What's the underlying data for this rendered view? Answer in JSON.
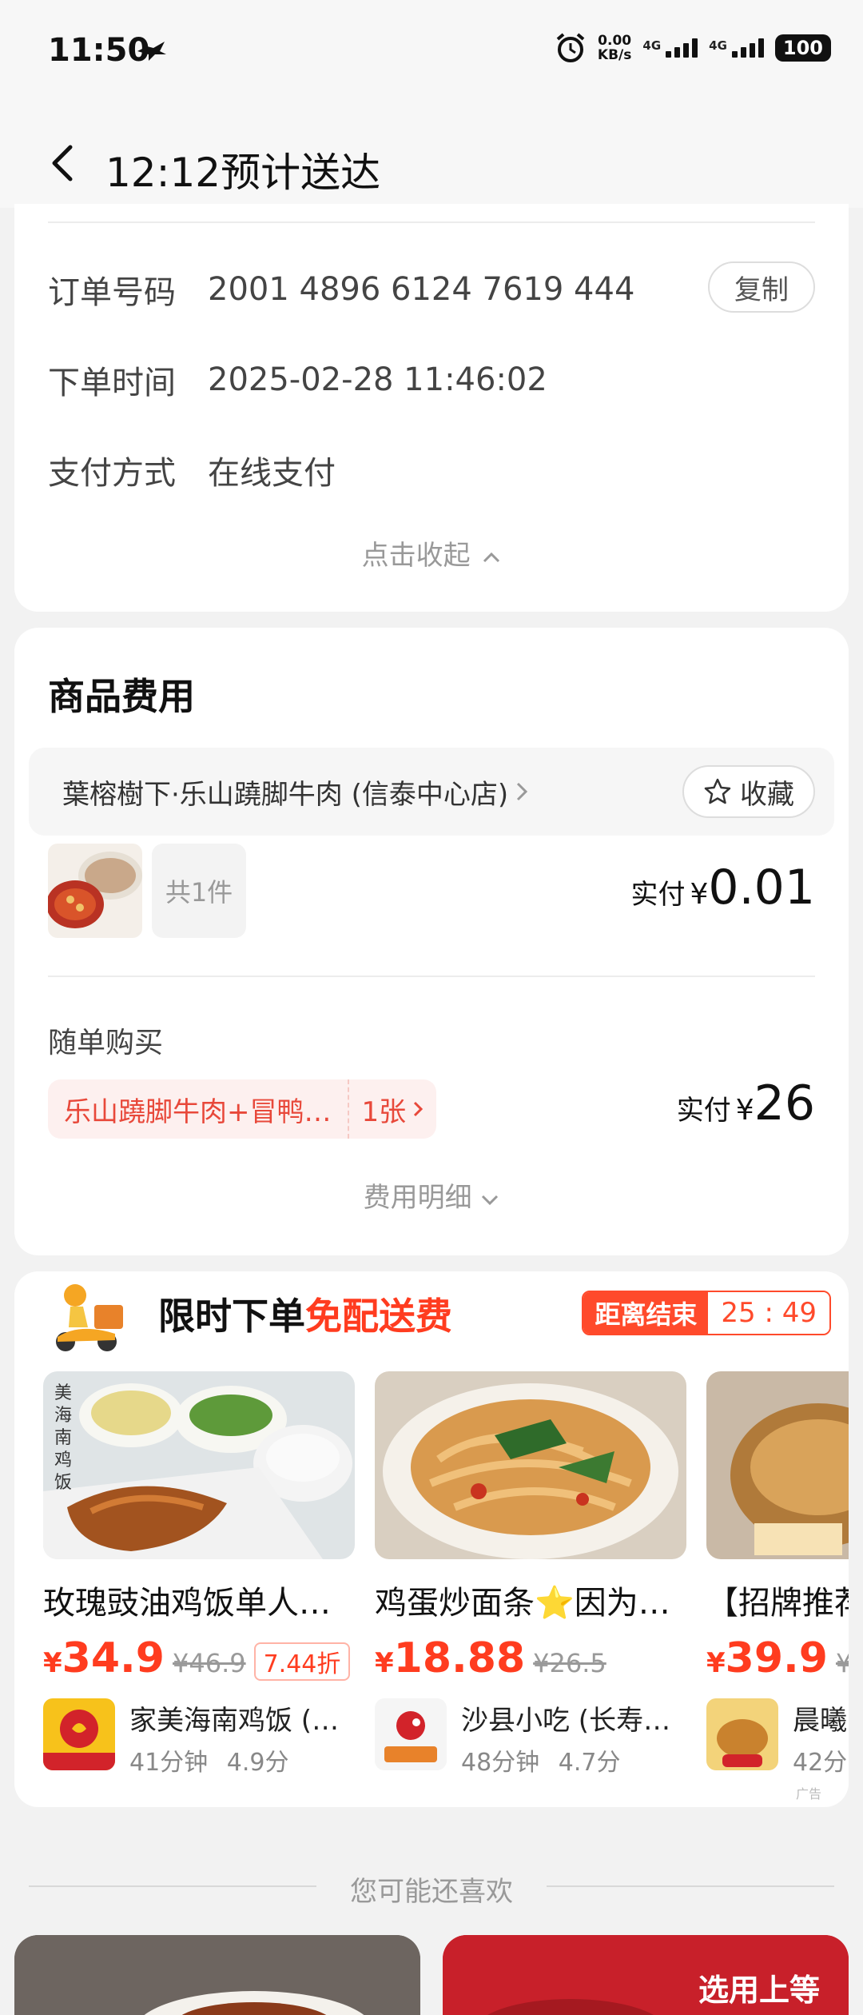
{
  "status_bar": {
    "time": "11:50",
    "net_speed": "0.00",
    "net_unit": "KB/s",
    "sig1": "4G",
    "sig2": "4G",
    "battery": "100"
  },
  "header": {
    "title": "12:12预计送达"
  },
  "order_info": {
    "order_no_label": "订单号码",
    "order_no": "2001 4896 6124 7619 444",
    "copy_label": "复制",
    "time_label": "下单时间",
    "time": "2025-02-28 11:46:02",
    "pay_label": "支付方式",
    "pay": "在线支付",
    "collapse_label": "点击收起"
  },
  "goods": {
    "title": "商品费用",
    "shop_name": "葉榕樹下·乐山蹺脚牛肉 (信泰中心店)",
    "fav_label": "收藏",
    "count_label": "共1件",
    "paid_label": "实付",
    "currency": "¥",
    "paid_amount": "0.01",
    "addon_title": "随单购买",
    "coupon_name": "乐山蹺脚牛肉+冒鸭…",
    "coupon_count": "1张",
    "addon_paid_amount": "26",
    "detail_label": "费用明细"
  },
  "promo": {
    "title_main": "限时下单",
    "title_highlight": "免配送费",
    "timer_label": "距离结束",
    "timer_value": "25 : 49",
    "ad_label": "广告",
    "deals": [
      {
        "name": "玫瑰豉油鸡饭单人…",
        "currency": "¥",
        "price": "34.9",
        "old_price": "¥46.9",
        "discount": "7.44折",
        "store": "家美海南鸡饭 (…",
        "time": "41分钟",
        "score": "4.9分"
      },
      {
        "name": "鸡蛋炒面条⭐因为…",
        "currency": "¥",
        "price": "18.88",
        "old_price": "¥26.5",
        "discount": "",
        "store": "沙县小吃 (长寿…",
        "time": "48分钟",
        "score": "4.7分"
      },
      {
        "name": "【招牌推荐",
        "currency": "¥",
        "price": "39.9",
        "old_price": "¥8",
        "discount": "",
        "store": "晨曦",
        "time": "42分",
        "score": ""
      }
    ]
  },
  "recommend": {
    "title": "您可能还喜欢",
    "banner_text": "选用上等"
  },
  "colors": {
    "accent": "#ff3c1f",
    "coupon_bg": "#fdf0ef"
  }
}
